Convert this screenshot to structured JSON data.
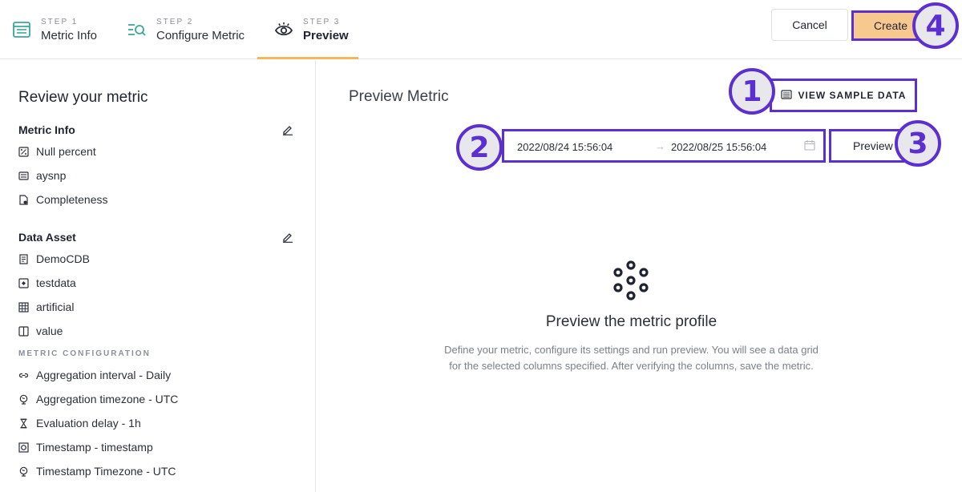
{
  "steps": [
    {
      "num": "STEP 1",
      "label": "Metric Info"
    },
    {
      "num": "STEP 2",
      "label": "Configure Metric"
    },
    {
      "num": "STEP 3",
      "label": "Preview"
    }
  ],
  "header": {
    "cancel_label": "Cancel",
    "create_label": "Create"
  },
  "badges": {
    "one": "1",
    "two": "2",
    "three": "3",
    "four": "4"
  },
  "left": {
    "title": "Review your metric",
    "metric_info": {
      "heading": "Metric Info",
      "items": [
        "Null percent",
        "aysnp",
        "Completeness"
      ]
    },
    "data_asset": {
      "heading": "Data Asset",
      "items": [
        "DemoCDB",
        "testdata",
        "artificial",
        "value"
      ]
    },
    "config": {
      "heading": "METRIC CONFIGURATION",
      "items": [
        "Aggregation interval - Daily",
        "Aggregation timezone - UTC",
        "Evaluation delay - 1h",
        "Timestamp - timestamp",
        "Timestamp Timezone - UTC"
      ]
    }
  },
  "main": {
    "title": "Preview Metric",
    "sample_label": "VIEW SAMPLE DATA",
    "range_start": "2022/08/24 15:56:04",
    "range_arrow": "→",
    "range_end": "2022/08/25 15:56:04",
    "preview_label": "Preview",
    "empty_title": "Preview the metric profile",
    "empty_desc": "Define your metric, configure its settings and run preview. You will see a data grid for the selected columns specified. After verifying the columns, save the metric."
  },
  "colors": {
    "accent": "#5b2fd0",
    "create_bg": "#f8c98f",
    "underline": "#f2b95a",
    "step_icon": "#3aa89a"
  }
}
